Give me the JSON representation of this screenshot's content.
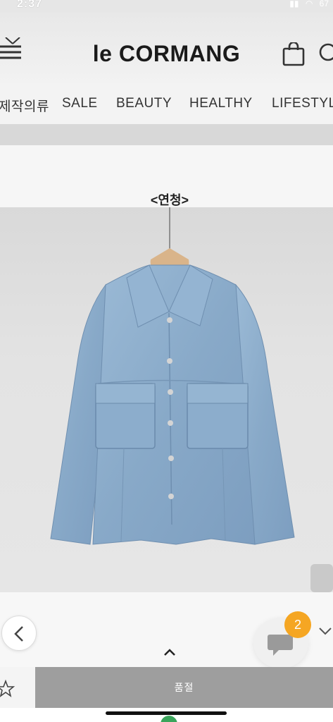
{
  "status_bar": {
    "time": "2:37",
    "icons": [
      "signal-icon",
      "wifi-icon"
    ],
    "battery": "67"
  },
  "header": {
    "logo": "le CORMANG",
    "icons": [
      "menu-icon",
      "cart-icon",
      "search-icon"
    ]
  },
  "nav": {
    "items": [
      "제작의류",
      "SALE",
      "BEAUTY",
      "HEALTHY",
      "LIFESTYL"
    ]
  },
  "product": {
    "color_label": "<연청>"
  },
  "chat": {
    "badge_count": "2"
  },
  "buy_bar": {
    "soldout_label": "품절"
  },
  "colors": {
    "denim": "#8fb0cf",
    "badge": "#f5a623",
    "soldout": "#9e9e9e"
  }
}
